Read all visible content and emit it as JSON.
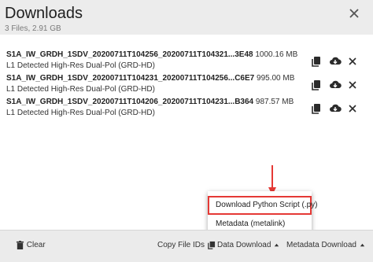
{
  "header": {
    "title": "Downloads",
    "subtitle": "3 Files, 2.91 GB"
  },
  "files": [
    {
      "name": "S1A_IW_GRDH_1SDV_20200711T104256_20200711T104321...3E48",
      "size": "1000.16 MB",
      "description": "L1 Detected High-Res Dual-Pol (GRD-HD)"
    },
    {
      "name": "S1A_IW_GRDH_1SDV_20200711T104231_20200711T104256...C6E7",
      "size": "995.00 MB",
      "description": "L1 Detected High-Res Dual-Pol (GRD-HD)"
    },
    {
      "name": "S1A_IW_GRDH_1SDV_20200711T104206_20200711T104231...B364",
      "size": "987.57 MB",
      "description": "L1 Detected High-Res Dual-Pol (GRD-HD)"
    }
  ],
  "menu": {
    "items": [
      "Download Python Script (.py)",
      "Metadata (metalink)"
    ]
  },
  "footer": {
    "clear": "Clear",
    "copy_ids": "Copy File IDs",
    "data_download": "Data Download",
    "metadata_download": "Metadata Download"
  },
  "icons": {
    "copy": "copy-icon",
    "download": "cloud-download-icon",
    "remove": "close-icon",
    "trash": "trash-icon",
    "caret": "caret-up-icon"
  },
  "colors": {
    "highlight": "#e53935",
    "header_bg": "#ececec",
    "footer_bg": "#ebebeb"
  }
}
